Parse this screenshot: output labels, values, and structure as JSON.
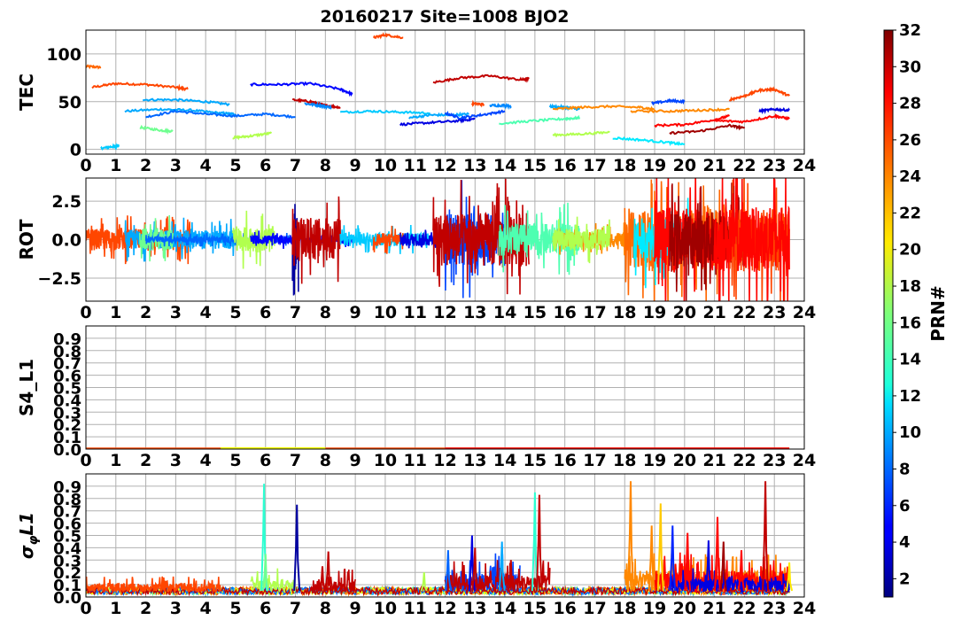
{
  "title": "20160217 Site=1008 BJO2",
  "chart_data": [
    {
      "type": "line",
      "ylabel": "TEC",
      "xlim": [
        0,
        24
      ],
      "ylim": [
        -5,
        125
      ],
      "yticks": [
        "0",
        "50",
        "100"
      ],
      "ytick_values": [
        0,
        50,
        100
      ],
      "xtick_labels": [
        "0",
        "1",
        "2",
        "3",
        "4",
        "5",
        "6",
        "7",
        "8",
        "9",
        "10",
        "11",
        "12",
        "13",
        "14",
        "15",
        "16",
        "17",
        "18",
        "19",
        "20",
        "21",
        "22",
        "23",
        "24"
      ],
      "grid": true,
      "series": [
        {
          "prn": 25,
          "x": [
            0,
            0.5
          ],
          "y": [
            87,
            86
          ]
        },
        {
          "prn": 26,
          "x": [
            0.2,
            1.0,
            2.0,
            3.0,
            3.4
          ],
          "y": [
            65,
            69,
            68,
            65,
            63
          ]
        },
        {
          "prn": 11,
          "x": [
            0.5,
            0.9,
            1.1
          ],
          "y": [
            1,
            3,
            4
          ]
        },
        {
          "prn": 10,
          "x": [
            1.3,
            2.5,
            3.5,
            4.5,
            5.0
          ],
          "y": [
            40,
            42,
            41,
            38,
            37
          ]
        },
        {
          "prn": 10,
          "x": [
            1.9,
            3.0,
            4.0,
            4.8
          ],
          "y": [
            52,
            52,
            50,
            47
          ]
        },
        {
          "prn": 16,
          "x": [
            1.8,
            2.5,
            2.9
          ],
          "y": [
            23,
            20,
            19
          ]
        },
        {
          "prn": 8,
          "x": [
            2.0,
            3.0,
            4.0,
            5.0,
            6.0,
            7.0
          ],
          "y": [
            34,
            40,
            37,
            35,
            37,
            34
          ]
        },
        {
          "prn": 18,
          "x": [
            4.9,
            5.5,
            6.2
          ],
          "y": [
            12,
            14,
            17
          ]
        },
        {
          "prn": 5,
          "x": [
            5.5,
            6.5,
            7.5,
            8.5,
            8.9
          ],
          "y": [
            68,
            68,
            69,
            63,
            58
          ]
        },
        {
          "prn": 30,
          "x": [
            6.9,
            7.5,
            8.0,
            8.5
          ],
          "y": [
            52,
            50,
            46,
            44
          ]
        },
        {
          "prn": 9,
          "x": [
            7.3,
            7.8,
            8.2
          ],
          "y": [
            48,
            46,
            44
          ]
        },
        {
          "prn": 11,
          "x": [
            8.5,
            9.5,
            10.5,
            11.5
          ],
          "y": [
            39,
            40,
            39,
            38
          ]
        },
        {
          "prn": 26,
          "x": [
            9.6,
            10.0,
            10.6
          ],
          "y": [
            117,
            120,
            117
          ]
        },
        {
          "prn": 4,
          "x": [
            10.5,
            11.5,
            12.5,
            13.0
          ],
          "y": [
            26,
            28,
            30,
            32
          ]
        },
        {
          "prn": 10,
          "x": [
            10.8,
            11.5,
            12.2,
            12.8
          ],
          "y": [
            33,
            36,
            36,
            37
          ]
        },
        {
          "prn": 30,
          "x": [
            11.6,
            12.5,
            13.5,
            14.5,
            14.8
          ],
          "y": [
            70,
            75,
            77,
            73,
            74
          ]
        },
        {
          "prn": 7,
          "x": [
            12.0,
            12.5,
            13.2,
            14.0
          ],
          "y": [
            38,
            33,
            36,
            40
          ]
        },
        {
          "prn": 26,
          "x": [
            12.9,
            13.3
          ],
          "y": [
            48,
            47
          ]
        },
        {
          "prn": 9,
          "x": [
            13.5,
            14.0,
            14.2
          ],
          "y": [
            46,
            46,
            45
          ]
        },
        {
          "prn": 15,
          "x": [
            13.8,
            15.0,
            16.0,
            16.5
          ],
          "y": [
            27,
            30,
            32,
            33
          ]
        },
        {
          "prn": 10,
          "x": [
            15.5,
            16.0,
            16.5
          ],
          "y": [
            45,
            44,
            42
          ]
        },
        {
          "prn": 24,
          "x": [
            15.6,
            16.5,
            17.5,
            18.5,
            19.0
          ],
          "y": [
            42,
            44,
            45,
            44,
            42
          ]
        },
        {
          "prn": 18,
          "x": [
            15.6,
            16.5,
            17.5
          ],
          "y": [
            15,
            16,
            18
          ]
        },
        {
          "prn": 12,
          "x": [
            17.6,
            18.5,
            19.5,
            20.0
          ],
          "y": [
            12,
            10,
            7,
            5
          ]
        },
        {
          "prn": 24,
          "x": [
            18.2,
            19.5,
            20.5,
            21.5
          ],
          "y": [
            40,
            40,
            41,
            42
          ]
        },
        {
          "prn": 7,
          "x": [
            18.9,
            19.5,
            20.0
          ],
          "y": [
            48,
            51,
            50
          ]
        },
        {
          "prn": 28,
          "x": [
            19.0,
            20.0,
            21.0,
            21.5
          ],
          "y": [
            25,
            26,
            31,
            35
          ]
        },
        {
          "prn": 31,
          "x": [
            19.5,
            20.5,
            21.5,
            22.0
          ],
          "y": [
            17,
            19,
            25,
            22
          ]
        },
        {
          "prn": 26,
          "x": [
            21.5,
            22.0,
            22.5,
            23.0,
            23.5
          ],
          "y": [
            52,
            56,
            62,
            63,
            56
          ]
        },
        {
          "prn": 28,
          "x": [
            21.0,
            22.0,
            23.0,
            23.5
          ],
          "y": [
            30,
            29,
            35,
            32
          ]
        },
        {
          "prn": 4,
          "x": [
            22.5,
            23.0,
            23.5
          ],
          "y": [
            40,
            42,
            41
          ]
        }
      ]
    },
    {
      "type": "line",
      "ylabel": "ROT",
      "xlim": [
        0,
        24
      ],
      "ylim": [
        -4,
        4
      ],
      "yticks": [
        "−2.5",
        "0.0",
        "2.5"
      ],
      "ytick_values": [
        -2.5,
        0,
        2.5
      ],
      "xtick_labels": [
        "0",
        "1",
        "2",
        "3",
        "4",
        "5",
        "6",
        "7",
        "8",
        "9",
        "10",
        "11",
        "12",
        "13",
        "14",
        "15",
        "16",
        "17",
        "18",
        "19",
        "20",
        "21",
        "22",
        "23",
        "24"
      ],
      "grid": true,
      "series": [
        {
          "prn": 26,
          "x": [
            0,
            3.5
          ],
          "amplitude": 1.0
        },
        {
          "prn": 10,
          "x": [
            1.3,
            5.0
          ],
          "amplitude": 0.9
        },
        {
          "prn": 16,
          "x": [
            1.8,
            2.9
          ],
          "amplitude": 1.0
        },
        {
          "prn": 8,
          "x": [
            2.0,
            7.0
          ],
          "amplitude": 0.3
        },
        {
          "prn": 18,
          "x": [
            4.9,
            6.3
          ],
          "amplitude": 1.2
        },
        {
          "prn": 5,
          "x": [
            5.5,
            8.9
          ],
          "amplitude": 0.4
        },
        {
          "prn": 2,
          "x": [
            6.9,
            7.1
          ],
          "amplitude": 2.5
        },
        {
          "prn": 30,
          "x": [
            6.9,
            8.5
          ],
          "amplitude": 2.0
        },
        {
          "prn": 11,
          "x": [
            8.5,
            11.5
          ],
          "amplitude": 0.6
        },
        {
          "prn": 26,
          "x": [
            9.6,
            10.6
          ],
          "amplitude": 0.6
        },
        {
          "prn": 4,
          "x": [
            10.5,
            13.0
          ],
          "amplitude": 0.6
        },
        {
          "prn": 7,
          "x": [
            12.0,
            14.0
          ],
          "amplitude": 2.5
        },
        {
          "prn": 30,
          "x": [
            11.6,
            14.8
          ],
          "amplitude": 2.5
        },
        {
          "prn": 15,
          "x": [
            13.8,
            16.5
          ],
          "amplitude": 1.5
        },
        {
          "prn": 24,
          "x": [
            15.6,
            19.0
          ],
          "amplitude": 0.7
        },
        {
          "prn": 18,
          "x": [
            15.6,
            17.5
          ],
          "amplitude": 1.0
        },
        {
          "prn": 25,
          "x": [
            18.0,
            21.5
          ],
          "amplitude": 3.0
        },
        {
          "prn": 12,
          "x": [
            18.3,
            20.3
          ],
          "amplitude": 2.0
        },
        {
          "prn": 28,
          "x": [
            19.0,
            22.0
          ],
          "amplitude": 3.0
        },
        {
          "prn": 31,
          "x": [
            19.5,
            22.0
          ],
          "amplitude": 2.5
        },
        {
          "prn": 26,
          "x": [
            21.5,
            23.5
          ],
          "amplitude": 3.0
        },
        {
          "prn": 28,
          "x": [
            21.0,
            23.5
          ],
          "amplitude": 3.0
        }
      ]
    },
    {
      "type": "line",
      "ylabel": "S4_L1",
      "xlim": [
        0,
        24
      ],
      "ylim": [
        0,
        1
      ],
      "yticks": [
        "0.0",
        "0.1",
        "0.2",
        "0.3",
        "0.4",
        "0.5",
        "0.6",
        "0.7",
        "0.8",
        "0.9"
      ],
      "ytick_values": [
        0,
        0.1,
        0.2,
        0.3,
        0.4,
        0.5,
        0.6,
        0.7,
        0.8,
        0.9
      ],
      "xtick_labels": [
        "0",
        "1",
        "2",
        "3",
        "4",
        "5",
        "6",
        "7",
        "8",
        "9",
        "10",
        "11",
        "12",
        "13",
        "14",
        "15",
        "16",
        "17",
        "18",
        "19",
        "20",
        "21",
        "22",
        "23",
        "24"
      ],
      "grid": true,
      "series": [
        {
          "prn": 26,
          "x": [
            0,
            23.5
          ],
          "y": [
            0.005,
            0.005
          ]
        },
        {
          "prn": 20,
          "x": [
            4.5,
            8.0
          ],
          "y": [
            0.008,
            0.008
          ]
        },
        {
          "prn": 28,
          "x": [
            12.0,
            23.5
          ],
          "y": [
            0.005,
            0.005
          ]
        }
      ]
    },
    {
      "type": "line",
      "ylabel": "σ_φL1",
      "xlim": [
        0,
        24
      ],
      "ylim": [
        0,
        1
      ],
      "yticks": [
        "0.0",
        "0.1",
        "0.2",
        "0.3",
        "0.4",
        "0.5",
        "0.6",
        "0.7",
        "0.8",
        "0.9"
      ],
      "ytick_values": [
        0,
        0.1,
        0.2,
        0.3,
        0.4,
        0.5,
        0.6,
        0.7,
        0.8,
        0.9
      ],
      "xtick_labels": [
        "0",
        "1",
        "2",
        "3",
        "4",
        "5",
        "6",
        "7",
        "8",
        "9",
        "10",
        "11",
        "12",
        "13",
        "14",
        "15",
        "16",
        "17",
        "18",
        "19",
        "20",
        "21",
        "22",
        "23",
        "24"
      ],
      "grid": true,
      "baseline": 0.05,
      "spikes": [
        {
          "prn": 14,
          "x": 5.95,
          "y": 0.92
        },
        {
          "prn": 16,
          "x": 6.0,
          "y": 0.35
        },
        {
          "prn": 2,
          "x": 7.05,
          "y": 0.75
        },
        {
          "prn": 30,
          "x": 7.9,
          "y": 0.25
        },
        {
          "prn": 30,
          "x": 8.1,
          "y": 0.37
        },
        {
          "prn": 18,
          "x": 11.3,
          "y": 0.2
        },
        {
          "prn": 8,
          "x": 12.1,
          "y": 0.38
        },
        {
          "prn": 4,
          "x": 12.9,
          "y": 0.5
        },
        {
          "prn": 30,
          "x": 13.0,
          "y": 0.4
        },
        {
          "prn": 10,
          "x": 13.9,
          "y": 0.45
        },
        {
          "prn": 30,
          "x": 14.2,
          "y": 0.3
        },
        {
          "prn": 14,
          "x": 15.0,
          "y": 0.85
        },
        {
          "prn": 30,
          "x": 15.15,
          "y": 0.83
        },
        {
          "prn": 24,
          "x": 18.2,
          "y": 0.94
        },
        {
          "prn": 24,
          "x": 18.9,
          "y": 0.58
        },
        {
          "prn": 22,
          "x": 19.2,
          "y": 0.76
        },
        {
          "prn": 6,
          "x": 19.6,
          "y": 0.58
        },
        {
          "prn": 28,
          "x": 20.1,
          "y": 0.52
        },
        {
          "prn": 4,
          "x": 20.8,
          "y": 0.46
        },
        {
          "prn": 28,
          "x": 21.1,
          "y": 0.65
        },
        {
          "prn": 31,
          "x": 21.3,
          "y": 0.45
        },
        {
          "prn": 28,
          "x": 21.9,
          "y": 0.38
        },
        {
          "prn": 30,
          "x": 22.7,
          "y": 0.94
        },
        {
          "prn": 21,
          "x": 23.5,
          "y": 0.28
        }
      ],
      "activity_windows": [
        {
          "prn": 26,
          "x": [
            0,
            4.5
          ],
          "level": 0.1
        },
        {
          "prn": 18,
          "x": [
            5.5,
            7.0
          ],
          "level": 0.15
        },
        {
          "prn": 30,
          "x": [
            7.5,
            9.0
          ],
          "level": 0.15
        },
        {
          "prn": 7,
          "x": [
            12.0,
            14.5
          ],
          "level": 0.25
        },
        {
          "prn": 30,
          "x": [
            12.0,
            15.5
          ],
          "level": 0.2
        },
        {
          "prn": 24,
          "x": [
            18.0,
            23.5
          ],
          "level": 0.25
        },
        {
          "prn": 28,
          "x": [
            19.0,
            23.5
          ],
          "level": 0.25
        },
        {
          "prn": 4,
          "x": [
            19.5,
            23.5
          ],
          "level": 0.15
        }
      ]
    }
  ],
  "colorbar": {
    "label": "PRN#",
    "range": [
      1,
      32
    ],
    "ticks": [
      "2",
      "4",
      "6",
      "8",
      "10",
      "12",
      "14",
      "16",
      "18",
      "20",
      "22",
      "24",
      "26",
      "28",
      "30",
      "32"
    ],
    "tick_values": [
      2,
      4,
      6,
      8,
      10,
      12,
      14,
      16,
      18,
      20,
      22,
      24,
      26,
      28,
      30,
      32
    ],
    "colormap": "jet"
  }
}
